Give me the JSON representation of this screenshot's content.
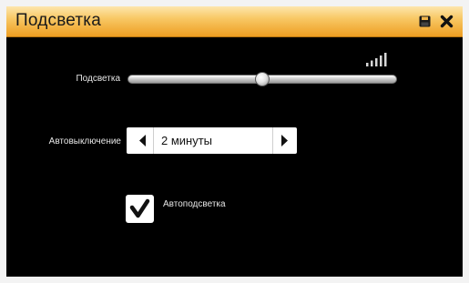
{
  "window": {
    "title": "Подсветка"
  },
  "icons": {
    "save": "save-icon",
    "close": "close-icon",
    "signal": "signal-strength-icon"
  },
  "backlight": {
    "label": "Подсветка",
    "level_fraction": 0.5
  },
  "auto_off": {
    "label": "Автовыключение",
    "value": "2 минуты"
  },
  "auto_backlight": {
    "label": "Автоподсветка",
    "checked": true
  }
}
